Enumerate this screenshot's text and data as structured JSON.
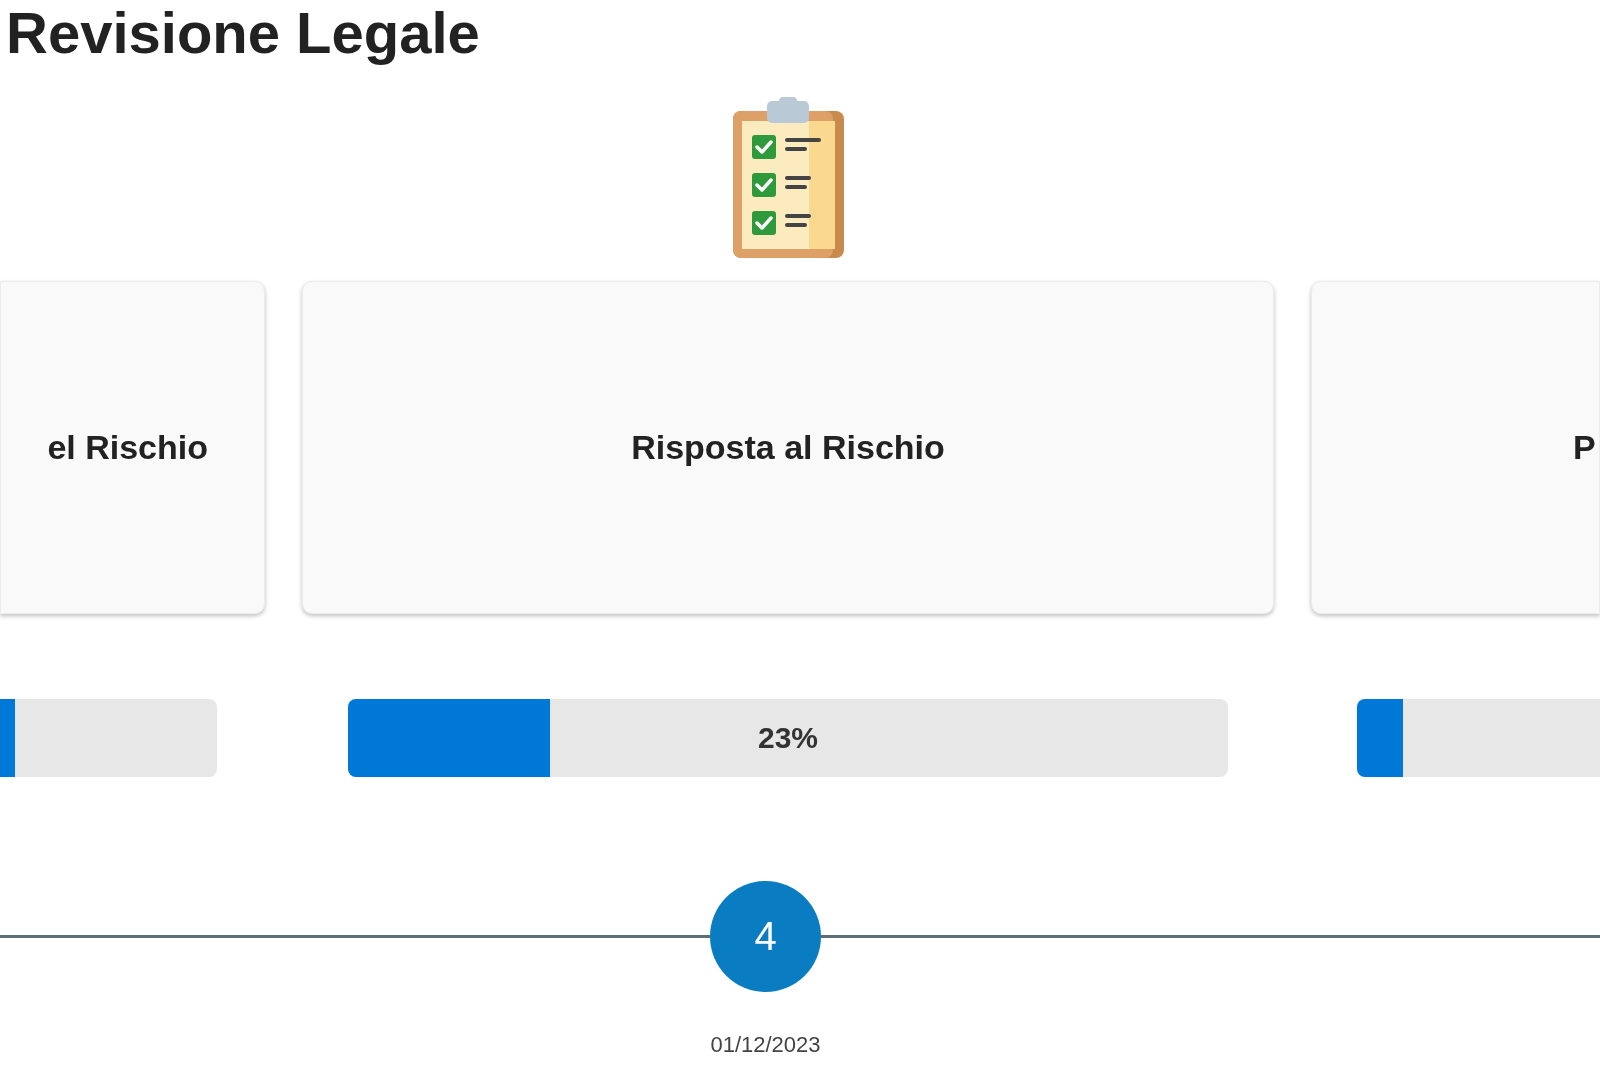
{
  "page": {
    "title": "Revisione Legale"
  },
  "phases": [
    {
      "title": "el Rischio",
      "current": false,
      "progress": {
        "level": 0.07
      }
    },
    {
      "title": "Risposta al Rischio",
      "current": true,
      "progress": {
        "level": 0.23,
        "label": "23%"
      }
    },
    {
      "title": "P",
      "current": false,
      "progress": {
        "level": 0.19
      }
    }
  ],
  "timeline": {
    "step": "4",
    "date": "01/12/2023"
  }
}
